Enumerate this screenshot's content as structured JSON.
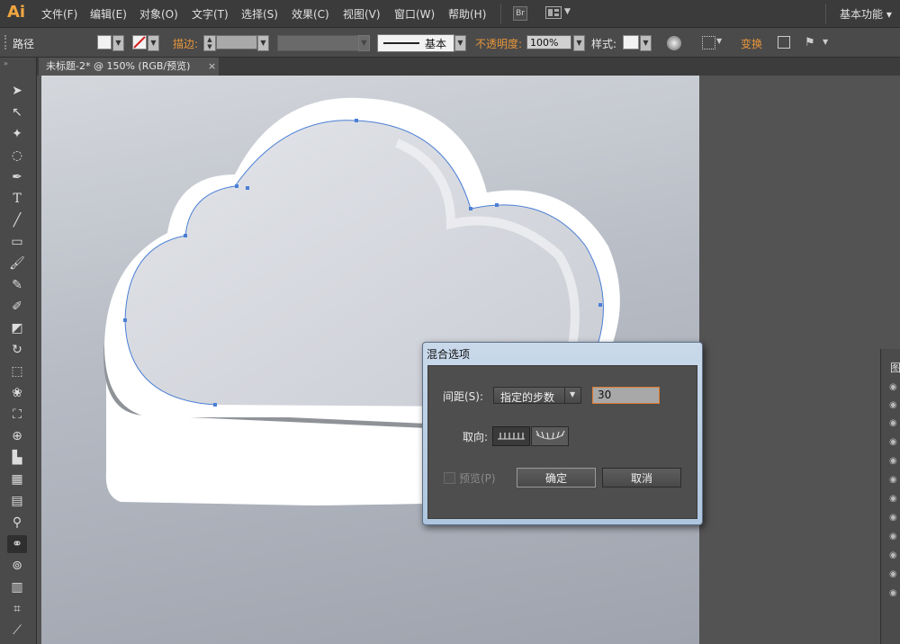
{
  "app": {
    "logo": "Ai",
    "workspace": "基本功能 ▾"
  },
  "menu": [
    "文件(F)",
    "编辑(E)",
    "对象(O)",
    "文字(T)",
    "选择(S)",
    "效果(C)",
    "视图(V)",
    "窗口(W)",
    "帮助(H)"
  ],
  "menu_icons": {
    "bridge": "Br"
  },
  "control_bar": {
    "selection": "路径",
    "stroke_label": "描边:",
    "basic_label": "基本",
    "opacity_label": "不透明度:",
    "opacity_value": "100%",
    "style_label": "样式:",
    "transform_label": "变换"
  },
  "document_tab": {
    "title": "未标题-2* @ 150% (RGB/预览)",
    "close": "×"
  },
  "right_panel": {
    "header": "图"
  },
  "dialog": {
    "title": "混合选项",
    "spacing_label": "间距(S):",
    "spacing_option": "指定的步数",
    "steps_value": "30",
    "orientation_label": "取向:",
    "preview_label": "预览(P)",
    "ok": "确定",
    "cancel": "取消"
  }
}
